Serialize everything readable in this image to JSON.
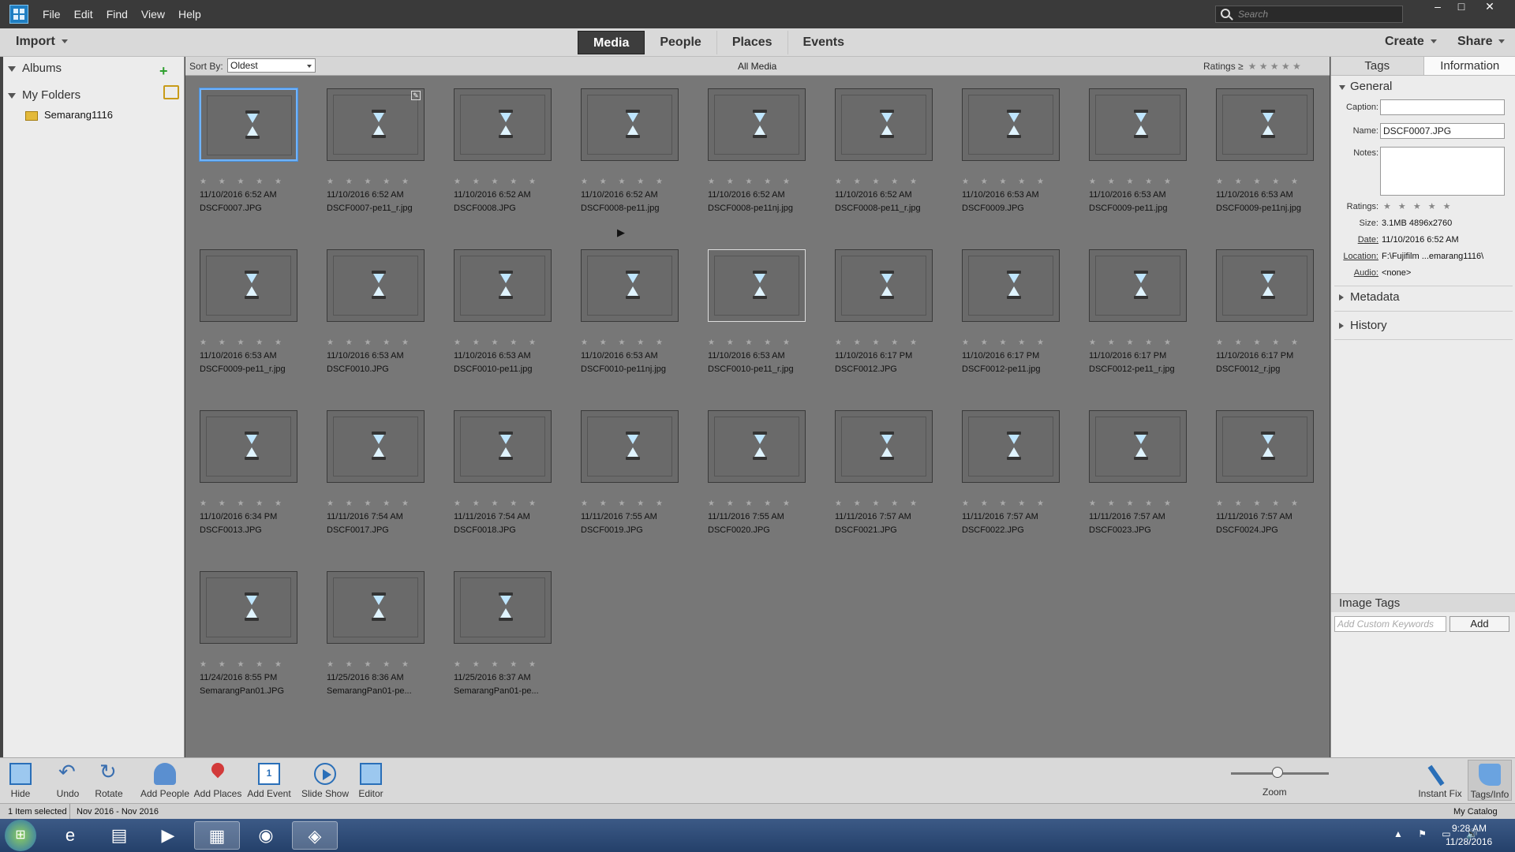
{
  "menu": [
    "File",
    "Edit",
    "Find",
    "View",
    "Help"
  ],
  "search": {
    "placeholder": "Search"
  },
  "window": {
    "minimize": "–",
    "maximize": "□",
    "close": "✕"
  },
  "toolbar": {
    "import": "Import",
    "create": "Create",
    "share": "Share",
    "tabs": [
      "Media",
      "People",
      "Places",
      "Events"
    ],
    "active_tab": "Media"
  },
  "left": {
    "albums": "Albums",
    "albums_add": "+",
    "folders": "My Folders",
    "folder_item": "Semarang1116"
  },
  "subbar": {
    "sort_label": "Sort By:",
    "sort_value": "Oldest",
    "title": "All Media",
    "ratings_label": "Ratings",
    "ratings_op": "≥",
    "ratings_stars": "★ ★ ★ ★ ★"
  },
  "grid": {
    "stars": "★ ★ ★ ★ ★",
    "items": [
      {
        "date": "11/10/2016 6:52 AM",
        "name": "DSCF0007.JPG",
        "state": "selected"
      },
      {
        "date": "11/10/2016 6:52 AM",
        "name": "DSCF0007-pe11_r.jpg",
        "state": "edited"
      },
      {
        "date": "11/10/2016 6:52 AM",
        "name": "DSCF0008.JPG"
      },
      {
        "date": "11/10/2016 6:52 AM",
        "name": "DSCF0008-pe11.jpg"
      },
      {
        "date": "11/10/2016 6:52 AM",
        "name": "DSCF0008-pe11nj.jpg"
      },
      {
        "date": "11/10/2016 6:52 AM",
        "name": "DSCF0008-pe11_r.jpg"
      },
      {
        "date": "11/10/2016 6:53 AM",
        "name": "DSCF0009.JPG"
      },
      {
        "date": "11/10/2016 6:53 AM",
        "name": "DSCF0009-pe11.jpg"
      },
      {
        "date": "11/10/2016 6:53 AM",
        "name": "DSCF0009-pe11nj.jpg"
      },
      {
        "date": "11/10/2016 6:53 AM",
        "name": "DSCF0009-pe11_r.jpg"
      },
      {
        "date": "11/10/2016 6:53 AM",
        "name": "DSCF0010.JPG"
      },
      {
        "date": "11/10/2016 6:53 AM",
        "name": "DSCF0010-pe11.jpg"
      },
      {
        "date": "11/10/2016 6:53 AM",
        "name": "DSCF0010-pe11nj.jpg"
      },
      {
        "date": "11/10/2016 6:53 AM",
        "name": "DSCF0010-pe11_r.jpg",
        "state": "hover"
      },
      {
        "date": "11/10/2016 6:17 PM",
        "name": "DSCF0012.JPG"
      },
      {
        "date": "11/10/2016 6:17 PM",
        "name": "DSCF0012-pe11.jpg"
      },
      {
        "date": "11/10/2016 6:17 PM",
        "name": "DSCF0012-pe11_r.jpg"
      },
      {
        "date": "11/10/2016 6:17 PM",
        "name": "DSCF0012_r.jpg"
      },
      {
        "date": "11/10/2016 6:34 PM",
        "name": "DSCF0013.JPG"
      },
      {
        "date": "11/11/2016 7:54 AM",
        "name": "DSCF0017.JPG"
      },
      {
        "date": "11/11/2016 7:54 AM",
        "name": "DSCF0018.JPG"
      },
      {
        "date": "11/11/2016 7:55 AM",
        "name": "DSCF0019.JPG"
      },
      {
        "date": "11/11/2016 7:55 AM",
        "name": "DSCF0020.JPG"
      },
      {
        "date": "11/11/2016 7:57 AM",
        "name": "DSCF0021.JPG"
      },
      {
        "date": "11/11/2016 7:57 AM",
        "name": "DSCF0022.JPG"
      },
      {
        "date": "11/11/2016 7:57 AM",
        "name": "DSCF0023.JPG"
      },
      {
        "date": "11/11/2016 7:57 AM",
        "name": "DSCF0024.JPG"
      },
      {
        "date": "11/24/2016 8:55 PM",
        "name": "SemarangPan01.JPG"
      },
      {
        "date": "11/25/2016 8:36 AM",
        "name": "SemarangPan01-pe..."
      },
      {
        "date": "11/25/2016 8:37 AM",
        "name": "SemarangPan01-pe..."
      }
    ]
  },
  "right": {
    "tab_tags": "Tags",
    "tab_info": "Information",
    "general": "General",
    "caption_label": "Caption:",
    "caption_value": "",
    "name_label": "Name:",
    "name_value": "DSCF0007.JPG",
    "notes_label": "Notes:",
    "notes_value": "",
    "ratings_label": "Ratings:",
    "ratings_stars": "★ ★ ★ ★ ★",
    "size_label": "Size:",
    "size_value": "3.1MB  4896x2760",
    "date_label": "Date:",
    "date_value": "11/10/2016 6:52 AM",
    "location_label": "Location:",
    "location_value": "F:\\Fujifilm ...emarang1116\\",
    "audio_label": "Audio:",
    "audio_value": "<none>",
    "metadata": "Metadata",
    "history": "History",
    "image_tags": "Image Tags",
    "kw_placeholder": "Add Custom Keywords",
    "add": "Add"
  },
  "bottom": {
    "hide": "Hide",
    "undo": "Undo",
    "rotate": "Rotate",
    "add_people": "Add People",
    "add_places": "Add Places",
    "add_event": "Add Event",
    "slideshow": "Slide Show",
    "editor": "Editor",
    "zoom": "Zoom",
    "instant_fix": "Instant Fix",
    "tags_info": "Tags/Info",
    "event_icon_text": "1"
  },
  "status": {
    "selected": "1 Item selected",
    "range": "Nov 2016 - Nov 2016",
    "catalog": "My Catalog"
  },
  "taskbar": {
    "time": "9:28 AM",
    "date": "11/28/2016",
    "tray": "▲ ⚑ ▭ 🔊"
  }
}
